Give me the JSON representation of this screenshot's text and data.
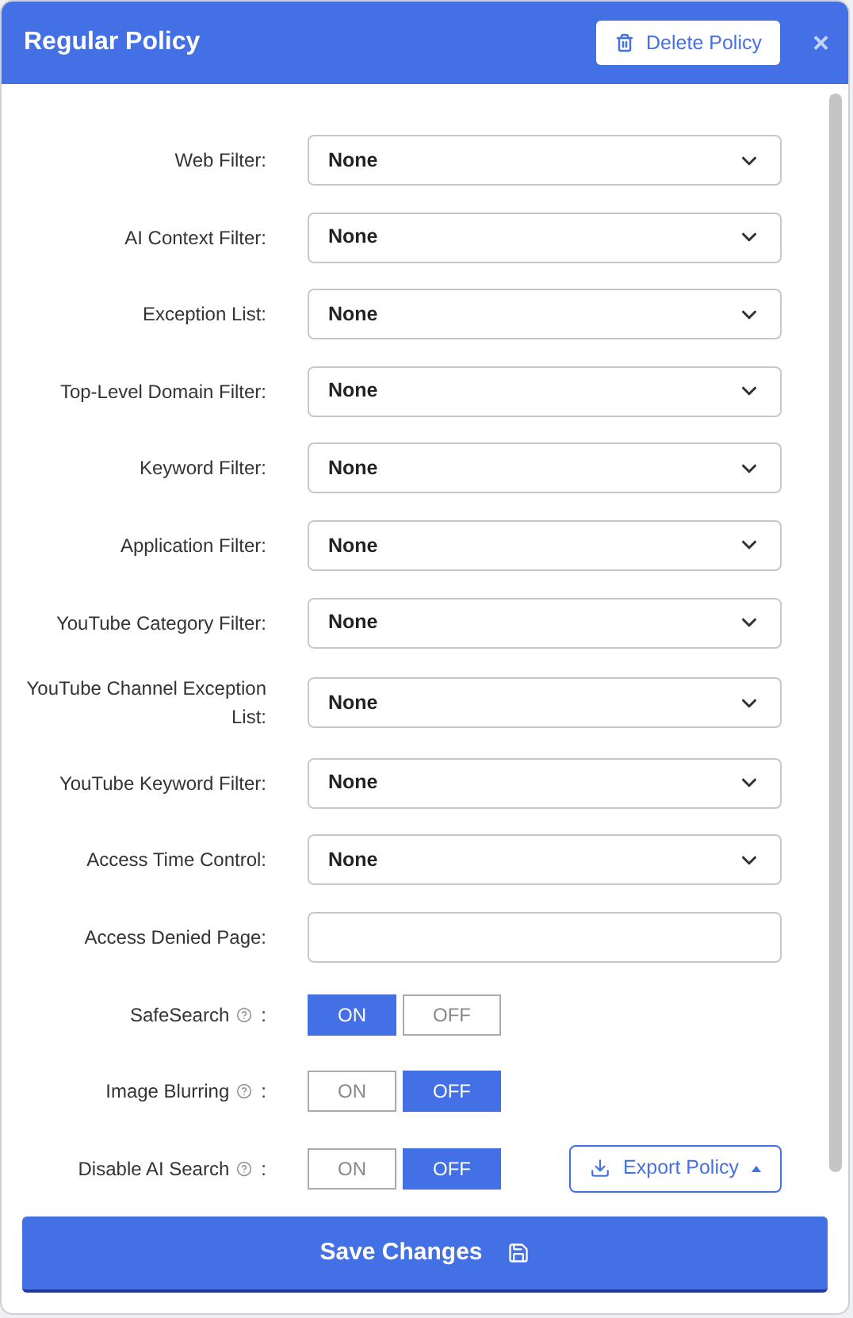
{
  "header": {
    "title": "Regular Policy",
    "delete_button": "Delete Policy",
    "close": "×"
  },
  "fields": [
    {
      "kind": "select",
      "label": "Web Filter:",
      "value": "None"
    },
    {
      "kind": "select",
      "label": "AI Context Filter:",
      "value": "None"
    },
    {
      "kind": "select",
      "label": "Exception List:",
      "value": "None"
    },
    {
      "kind": "select",
      "label": "Top-Level Domain Filter:",
      "value": "None"
    },
    {
      "kind": "select",
      "label": "Keyword Filter:",
      "value": "None"
    },
    {
      "kind": "select",
      "label": "Application Filter:",
      "value": "None"
    },
    {
      "kind": "select",
      "label": "YouTube Category Filter:",
      "value": "None"
    },
    {
      "kind": "select",
      "label": "YouTube Channel Exception List:",
      "value": "None"
    },
    {
      "kind": "select",
      "label": "YouTube Keyword Filter:",
      "value": "None"
    },
    {
      "kind": "select",
      "label": "Access Time Control:",
      "value": "None"
    },
    {
      "kind": "text",
      "label": "Access Denied Page:"
    },
    {
      "kind": "toggle",
      "label": "SafeSearch",
      "colon": ":",
      "options": [
        {
          "label": "ON",
          "selected": true
        },
        {
          "label": "OFF",
          "selected": false
        }
      ]
    },
    {
      "kind": "toggle",
      "label": "Image Blurring",
      "colon": ":",
      "options": [
        {
          "label": "ON",
          "selected": false
        },
        {
          "label": "OFF",
          "selected": true
        }
      ]
    },
    {
      "kind": "toggle",
      "label": "Disable AI Search",
      "colon": ":",
      "options": [
        {
          "label": "ON",
          "selected": false
        },
        {
          "label": "OFF",
          "selected": true
        }
      ]
    }
  ],
  "export_button": "Export Policy",
  "save_button": "Save Changes"
}
